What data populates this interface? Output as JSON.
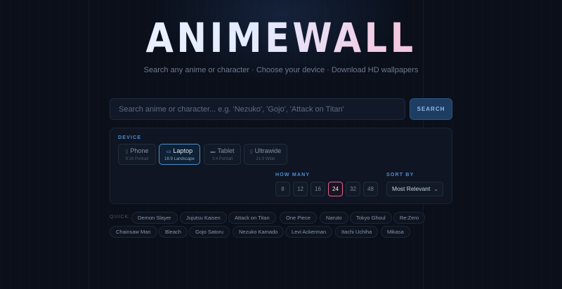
{
  "brand": {
    "logo": "ANIMEWALL",
    "tagline": "Search any anime or character · Choose your device · Download HD wallpapers"
  },
  "search": {
    "placeholder": "Search anime or character... e.g. 'Nezuko', 'Gojo', 'Attack on Titan'",
    "button_label": "SEARCH"
  },
  "device": {
    "label": "DEVICE",
    "options": [
      {
        "name": "Phone",
        "sub": "9:16 Portrait",
        "icon": "phone-icon",
        "glyph": "▯"
      },
      {
        "name": "Laptop",
        "sub": "16:9 Landscape",
        "icon": "laptop-icon",
        "glyph": "▭",
        "selected": true
      },
      {
        "name": "Tablet",
        "sub": "3:4 Portrait",
        "icon": "tablet-icon",
        "glyph": "▬"
      },
      {
        "name": "Ultrawide",
        "sub": "21:9 Wide",
        "icon": "monitor-icon",
        "glyph": "▯"
      }
    ]
  },
  "how_many": {
    "label": "HOW MANY",
    "options": [
      "8",
      "12",
      "16",
      "24",
      "32",
      "48"
    ],
    "selected": "24"
  },
  "sort": {
    "label": "SORT BY",
    "value": "Most Relevant"
  },
  "quick": {
    "label": "QUICK:",
    "chips": [
      "Demon Slayer",
      "Jujutsu Kaisen",
      "Attack on Titan",
      "One Piece",
      "Naruto",
      "Tokyo Ghoul",
      "Re:Zero",
      "Chainsaw Man",
      "Bleach",
      "Gojo Satoru",
      "Nezuko Kamado",
      "Levi Ackerman",
      "Itachi Uchiha",
      "Mikasa"
    ]
  },
  "colors": {
    "accent": "#4d8fd6",
    "highlight": "#e0609c",
    "background": "#0a0f1a"
  }
}
